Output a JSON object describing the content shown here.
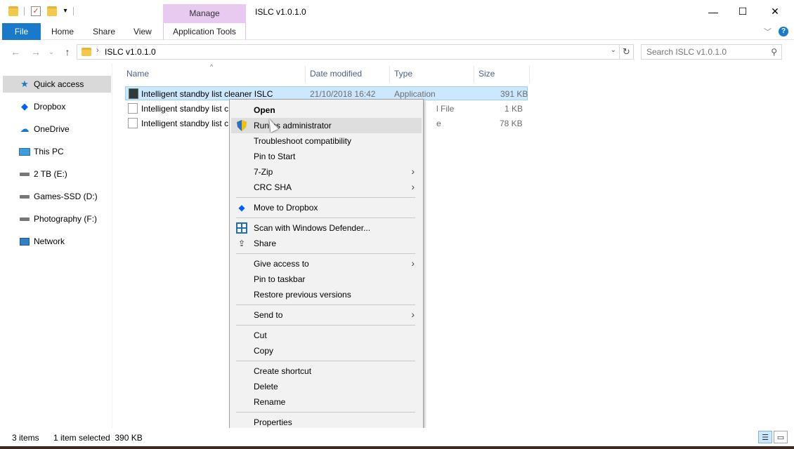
{
  "titlebar": {
    "manage_tab": "Manage",
    "window_title": "ISLC v1.0.1.0",
    "minimize": "—",
    "maximize": "☐",
    "close": "✕"
  },
  "ribbon": {
    "file": "File",
    "home": "Home",
    "share": "Share",
    "view": "View",
    "application_tools": "Application Tools",
    "help": "?"
  },
  "address": {
    "separator": "›",
    "path": "ISLC v1.0.1.0",
    "search_placeholder": "Search ISLC v1.0.1.0"
  },
  "sidebar": {
    "items": [
      {
        "label": "Quick access",
        "icon": "star-icon"
      },
      {
        "label": "Dropbox",
        "icon": "dropbox-icon"
      },
      {
        "label": "OneDrive",
        "icon": "cloud-icon"
      },
      {
        "label": "This PC",
        "icon": "monitor-icon"
      },
      {
        "label": "2 TB (E:)",
        "icon": "drive-icon"
      },
      {
        "label": "Games-SSD (D:)",
        "icon": "drive-icon"
      },
      {
        "label": "Photography (F:)",
        "icon": "drive-icon"
      },
      {
        "label": "Network",
        "icon": "network-icon"
      }
    ]
  },
  "filelist": {
    "columns": [
      "Name",
      "Date modified",
      "Type",
      "Size"
    ],
    "rows": [
      {
        "name": "Intelligent standby list cleaner ISLC",
        "date": "21/10/2018 16:42",
        "type": "Application",
        "size": "391 KB"
      },
      {
        "name": "Intelligent standby list c",
        "date": "",
        "type": "l File",
        "size": "1 KB"
      },
      {
        "name": "Intelligent standby list c",
        "date": "",
        "type": "e",
        "size": "78 KB"
      }
    ]
  },
  "context_menu": {
    "open": "Open",
    "run_as_admin": "Run as administrator",
    "troubleshoot": "Troubleshoot compatibility",
    "pin_start": "Pin to Start",
    "seven_zip": "7-Zip",
    "crc_sha": "CRC SHA",
    "move_dropbox": "Move to Dropbox",
    "scan_defender": "Scan with Windows Defender...",
    "share": "Share",
    "give_access": "Give access to",
    "pin_taskbar": "Pin to taskbar",
    "restore_versions": "Restore previous versions",
    "send_to": "Send to",
    "cut": "Cut",
    "copy": "Copy",
    "create_shortcut": "Create shortcut",
    "delete": "Delete",
    "rename": "Rename",
    "properties": "Properties"
  },
  "statusbar": {
    "items_count": "3 items",
    "selected_info": "1 item selected  390 KB"
  },
  "colors": {
    "file_tab": "#1979ca",
    "manage_tab": "#e8c9ef",
    "selection": "#cce8ff",
    "menu_bg": "#f2f2f2"
  }
}
